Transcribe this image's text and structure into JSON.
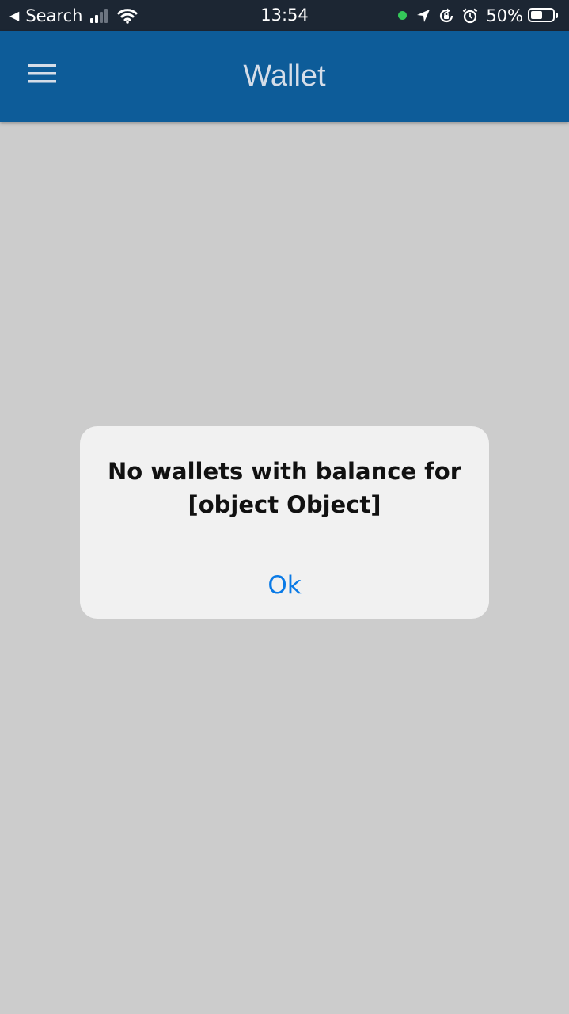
{
  "status_bar": {
    "back_label": "Search",
    "time": "13:54",
    "battery_percent": "50%",
    "battery_level": 0.5,
    "signal_bars": 2,
    "icons": [
      "back-arrow-icon",
      "cellular-signal-icon",
      "wifi-icon",
      "mic-in-use-dot-icon",
      "location-arrow-icon",
      "rotation-lock-icon",
      "alarm-icon",
      "battery-icon"
    ]
  },
  "app_bar": {
    "title": "Wallet",
    "menu_icon": "hamburger-menu-icon",
    "background_color": "#0d5c99"
  },
  "alert": {
    "message_line1": "No wallets with balance for",
    "message_line2": "[object Object]",
    "button_label": "Ok",
    "button_color": "#0a7ae6"
  }
}
